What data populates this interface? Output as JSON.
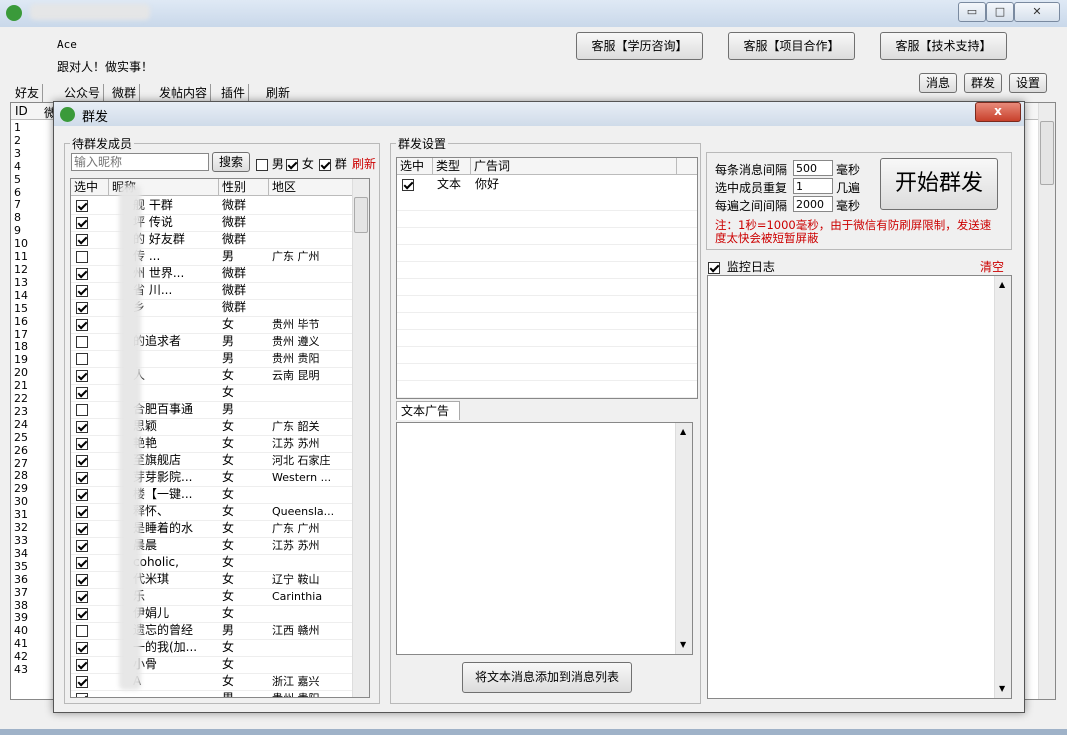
{
  "main_window": {
    "user_name": "Ace",
    "motto": "跟对人！做实事！",
    "service_buttons": [
      "客服【学历咨询】",
      "客服【项目合作】",
      "客服【技术支持】"
    ],
    "top_right_buttons": [
      "消息",
      "群发",
      "设置"
    ],
    "tabs": [
      "好友",
      "公众号",
      "微群",
      "发帖内容",
      "插件",
      "刷新"
    ],
    "list_header": [
      "ID",
      "微"
    ],
    "row_numbers": [
      "1",
      "2",
      "3",
      "4",
      "5",
      "6",
      "7",
      "8",
      "9",
      "10",
      "11",
      "12",
      "13",
      "14",
      "15",
      "16",
      "17",
      "18",
      "19",
      "20",
      "21",
      "22",
      "23",
      "24",
      "25",
      "26",
      "27",
      "28",
      "29",
      "30",
      "31",
      "32",
      "33",
      "34",
      "35",
      "36",
      "37",
      "38",
      "39",
      "40",
      "41",
      "42",
      "43"
    ]
  },
  "dialog": {
    "title": "群发",
    "close_label": "x",
    "members": {
      "caption": "待群发成员",
      "search_placeholder": "输入昵称",
      "search_button": "搜索",
      "filters": [
        {
          "label": "男",
          "checked": false
        },
        {
          "label": "女",
          "checked": true
        },
        {
          "label": "群",
          "checked": true
        }
      ],
      "refresh": "刷新",
      "columns": [
        "选中",
        "昵称",
        "性别",
        "地区"
      ],
      "rows": [
        {
          "checked": true,
          "name": "舰   干群",
          "gender": "微群",
          "region": ""
        },
        {
          "checked": true,
          "name": "坪   传说",
          "gender": "微群",
          "region": ""
        },
        {
          "checked": true,
          "name": "的   好友群",
          "gender": "微群",
          "region": ""
        },
        {
          "checked": false,
          "name": "传      ...",
          "gender": "男",
          "region": "广东 广州"
        },
        {
          "checked": true,
          "name": "州   世界...",
          "gender": "微群",
          "region": ""
        },
        {
          "checked": true,
          "name": "省   川...",
          "gender": "微群",
          "region": ""
        },
        {
          "checked": true,
          "name": "乡",
          "gender": "微群",
          "region": ""
        },
        {
          "checked": true,
          "name": "",
          "gender": "女",
          "region": "贵州 毕节"
        },
        {
          "checked": false,
          "name": "的追求者",
          "gender": "男",
          "region": "贵州 遵义"
        },
        {
          "checked": false,
          "name": "",
          "gender": "男",
          "region": "贵州 贵阳"
        },
        {
          "checked": true,
          "name": "人",
          "gender": "女",
          "region": "云南 昆明"
        },
        {
          "checked": true,
          "name": "",
          "gender": "女",
          "region": ""
        },
        {
          "checked": false,
          "name": "合肥百事通",
          "gender": "男",
          "region": ""
        },
        {
          "checked": true,
          "name": "思颖",
          "gender": "女",
          "region": "广东 韶关"
        },
        {
          "checked": true,
          "name": "艳艳",
          "gender": "女",
          "region": "江苏 苏州"
        },
        {
          "checked": true,
          "name": "至旗舰店",
          "gender": "女",
          "region": "河北 石家庄"
        },
        {
          "checked": true,
          "name": "芽芽影院...",
          "gender": "女",
          "region": "Western ..."
        },
        {
          "checked": true,
          "name": "楼【一键...",
          "gender": "女",
          "region": ""
        },
        {
          "checked": true,
          "name": "释怀、",
          "gender": "女",
          "region": "Queensla..."
        },
        {
          "checked": true,
          "name": "是睡着的水",
          "gender": "女",
          "region": "广东 广州"
        },
        {
          "checked": true,
          "name": "晨晨",
          "gender": "女",
          "region": "江苏 苏州"
        },
        {
          "checked": true,
          "name": "coholic,",
          "gender": "女",
          "region": ""
        },
        {
          "checked": true,
          "name": "代米琪",
          "gender": "女",
          "region": "辽宁 鞍山"
        },
        {
          "checked": true,
          "name": "乐",
          "gender": "女",
          "region": "Carinthia"
        },
        {
          "checked": true,
          "name": "伊娟儿",
          "gender": "女",
          "region": ""
        },
        {
          "checked": false,
          "name": "遗忘的曾经",
          "gender": "男",
          "region": "江西 赣州"
        },
        {
          "checked": true,
          "name": "一的我(加...",
          "gender": "女",
          "region": ""
        },
        {
          "checked": true,
          "name": "小骨",
          "gender": "女",
          "region": ""
        },
        {
          "checked": true,
          "name": "A",
          "gender": "女",
          "region": "浙江 嘉兴"
        },
        {
          "checked": true,
          "name": "",
          "gender": "男",
          "region": "贵州 贵阳"
        }
      ]
    },
    "settings": {
      "caption": "群发设置",
      "columns": [
        "选中",
        "类型",
        "广告词"
      ],
      "rows": [
        {
          "checked": true,
          "type": "文本",
          "text": "你好"
        }
      ],
      "text_ad_tab": "文本广告",
      "add_button": "将文本消息添加到消息列表"
    },
    "params": {
      "interval_label": "每条消息间隔",
      "interval_value": "500",
      "interval_unit": "毫秒",
      "repeat_label": "选中成员重复",
      "repeat_value": "1",
      "repeat_unit": "几遍",
      "round_label": "每遍之间间隔",
      "round_value": "2000",
      "round_unit": "毫秒",
      "start_button": "开始群发",
      "note": "注：1秒=1000毫秒，由于微信有防刷屏限制，发送速度太快会被短暂屏蔽"
    },
    "log": {
      "label": "监控日志",
      "checked": true,
      "clear": "清空"
    }
  },
  "colors": {
    "accent_red": "#cc0000",
    "title_bar": "#cfdbe9"
  }
}
